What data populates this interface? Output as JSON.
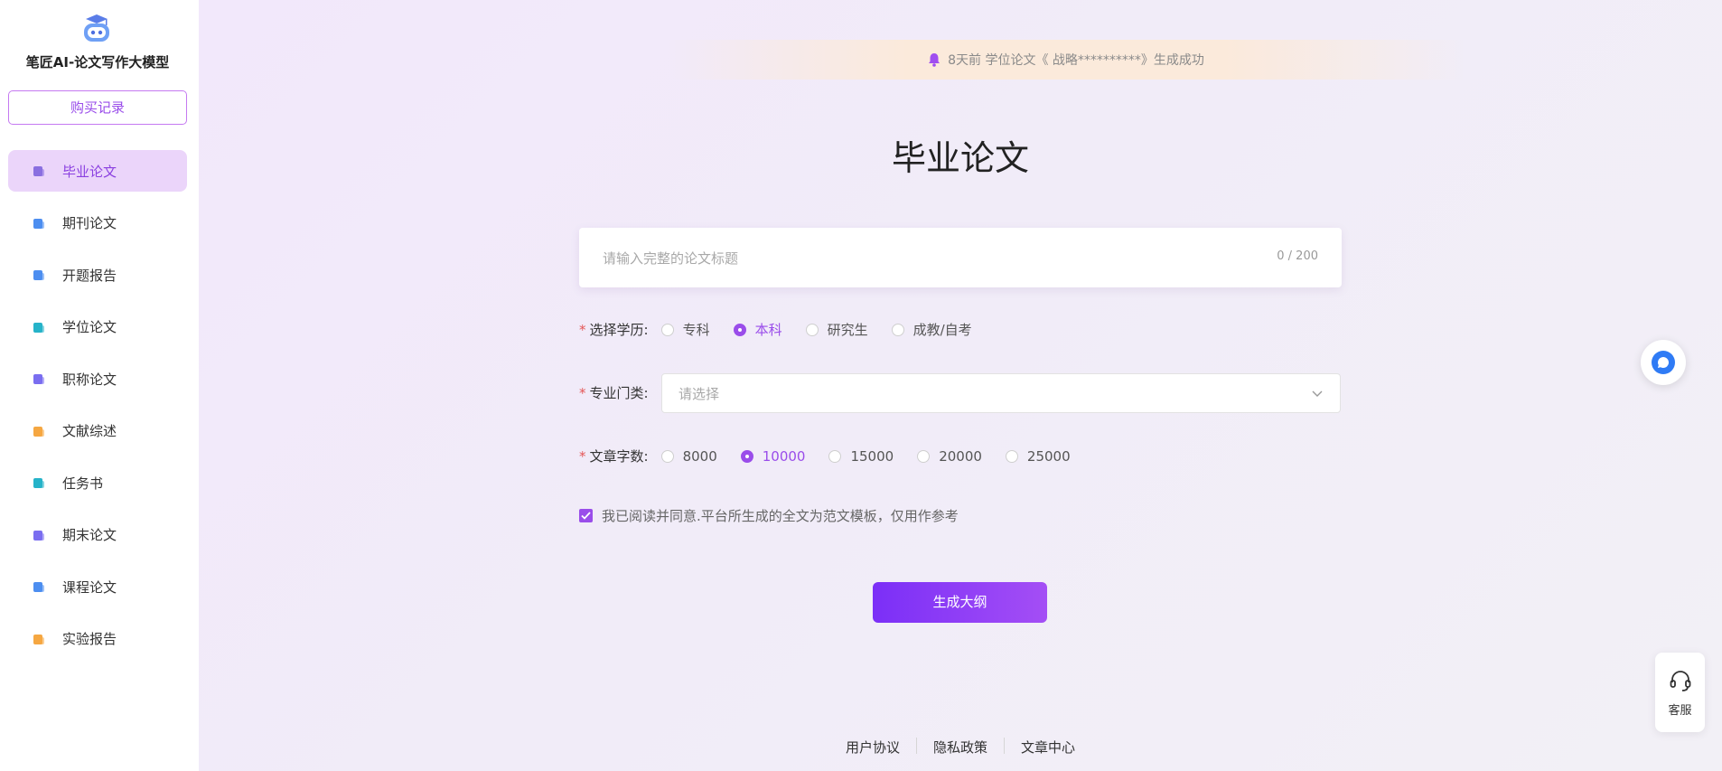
{
  "sidebar": {
    "brand": "笔匠AI-论文写作大模型",
    "buy_records": "购买记录",
    "items": [
      {
        "label": "毕业论文",
        "icon": "hat-icon",
        "active": true,
        "color": "#8a6fe0"
      },
      {
        "label": "期刊论文",
        "icon": "journal-icon",
        "active": false,
        "color": "#4d8ef0"
      },
      {
        "label": "开题报告",
        "icon": "report-icon",
        "active": false,
        "color": "#4d8ef0"
      },
      {
        "label": "学位论文",
        "icon": "degree-icon",
        "active": false,
        "color": "#26b3c9"
      },
      {
        "label": "职称论文",
        "icon": "title-icon",
        "active": false,
        "color": "#7a6ef0"
      },
      {
        "label": "文献综述",
        "icon": "folder-icon",
        "active": false,
        "color": "#f5a742"
      },
      {
        "label": "任务书",
        "icon": "task-icon",
        "active": false,
        "color": "#26b3c9"
      },
      {
        "label": "期末论文",
        "icon": "exam-icon",
        "active": false,
        "color": "#7a6ef0"
      },
      {
        "label": "课程论文",
        "icon": "course-icon",
        "active": false,
        "color": "#4d8ef0"
      },
      {
        "label": "实验报告",
        "icon": "lab-icon",
        "active": false,
        "color": "#f5a742"
      }
    ]
  },
  "notice": {
    "text": "8天前 学位论文《 战略**********》生成成功",
    "icon": "bell-icon"
  },
  "main": {
    "title": "毕业论文",
    "title_input": {
      "placeholder": "请输入完整的论文标题",
      "value": "",
      "counter": "0 / 200"
    },
    "education": {
      "label": "选择学历:",
      "options": [
        "专科",
        "本科",
        "研究生",
        "成教/自考"
      ],
      "selected": "本科"
    },
    "major": {
      "label": "专业门类:",
      "placeholder": "请选择"
    },
    "word_count": {
      "label": "文章字数:",
      "options": [
        "8000",
        "10000",
        "15000",
        "20000",
        "25000"
      ],
      "selected": "10000"
    },
    "agreement": {
      "text": "我已阅读并同意.平台所生成的全文为范文模板，仅用作参考",
      "checked": true
    },
    "generate_button": "生成大纲"
  },
  "footer": {
    "links": [
      "用户协议",
      "隐私政策",
      "文章中心"
    ]
  },
  "float": {
    "customer_service": "客服",
    "chat_icon": "chat-bubble-icon",
    "headset_icon": "headset-icon"
  },
  "colors": {
    "accent": "#9a4dea",
    "button_start": "#7b2ff7",
    "button_end": "#a44ef5",
    "required": "#e45656"
  }
}
